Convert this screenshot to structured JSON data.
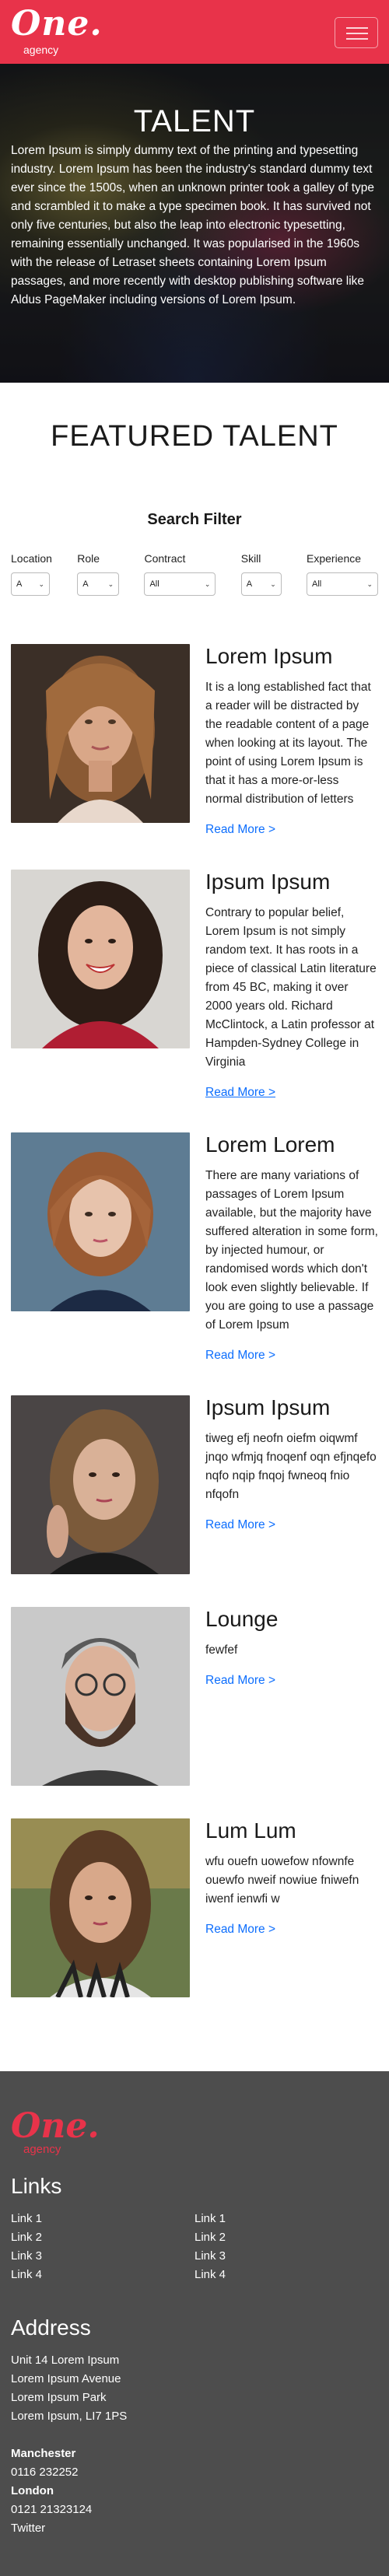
{
  "brand": {
    "logo_text": "One.",
    "sub": "agency"
  },
  "hero": {
    "title": "TALENT",
    "text": "Lorem Ipsum is simply dummy text of the printing and typesetting industry. Lorem Ipsum has been the industry's standard dummy text ever since the 1500s, when an unknown printer took a galley of type and scrambled it to make a type specimen book. It has survived not only five centuries, but also the leap into electronic typesetting, remaining essentially unchanged. It was popularised in the 1960s with the release of Letraset sheets containing Lorem Ipsum passages, and more recently with desktop publishing software like Aldus PageMaker including versions of Lorem Ipsum."
  },
  "featured": {
    "title": "FEATURED TALENT"
  },
  "search": {
    "title": "Search Filter",
    "filters": [
      {
        "label": "Location",
        "value": "A"
      },
      {
        "label": "Role",
        "value": "A"
      },
      {
        "label": "Contract",
        "value": "All"
      },
      {
        "label": "Skill",
        "value": "A"
      },
      {
        "label": "Experience",
        "value": "All"
      }
    ]
  },
  "talents": [
    {
      "name": "Lorem Ipsum",
      "desc": "It is a long established fact that a reader will be distracted by the readable content of a page when looking at its layout. The point of using Lorem Ipsum is that it has a more-or-less normal distribution of letters",
      "link": "Read More >"
    },
    {
      "name": "Ipsum Ipsum",
      "desc": "Contrary to popular belief, Lorem Ipsum is not simply random text. It has roots in a piece of classical Latin literature from 45 BC, making it over 2000 years old. Richard McClintock, a Latin professor at Hampden-Sydney College in Virginia",
      "link": "Read More >"
    },
    {
      "name": "Lorem Lorem",
      "desc": "There are many variations of passages of Lorem Ipsum available, but the majority have suffered alteration in some form, by injected humour, or randomised words which don't look even slightly believable. If you are going to use a passage of Lorem Ipsum",
      "link": "Read More >"
    },
    {
      "name": "Ipsum Ipsum",
      "desc": "tiweg efj neofn oiefm oiqwmf jnqo wfmjq fnoqenf oqn efjnqefo nqfo nqip fnqoj fwneoq fnio nfqofn",
      "link": "Read More >"
    },
    {
      "name": "Lounge",
      "desc": "fewfef",
      "link": "Read More >"
    },
    {
      "name": "Lum Lum",
      "desc": "wfu ouefn uowefow nfownfe ouewfo nweif nowiue fniwefn iwenf ienwfi w",
      "link": "Read More >"
    }
  ],
  "footer": {
    "logo_text": "One.",
    "sub": "agency",
    "links_title": "Links",
    "links_col1": [
      "Link 1",
      "Link 2",
      "Link 3",
      "Link 4"
    ],
    "links_col2": [
      "Link 1",
      "Link 2",
      "Link 3",
      "Link 4"
    ],
    "address_title": "Address",
    "address": [
      "Unit 14 Lorem Ipsum",
      "Lorem Ipsum Avenue",
      "Lorem Ipsum Park",
      "Lorem Ipsum, LI7 1PS"
    ],
    "city1": "Manchester",
    "phone1": "0116 232252",
    "city2": "London",
    "phone2": "0121 21323124",
    "social": "Twitter"
  }
}
